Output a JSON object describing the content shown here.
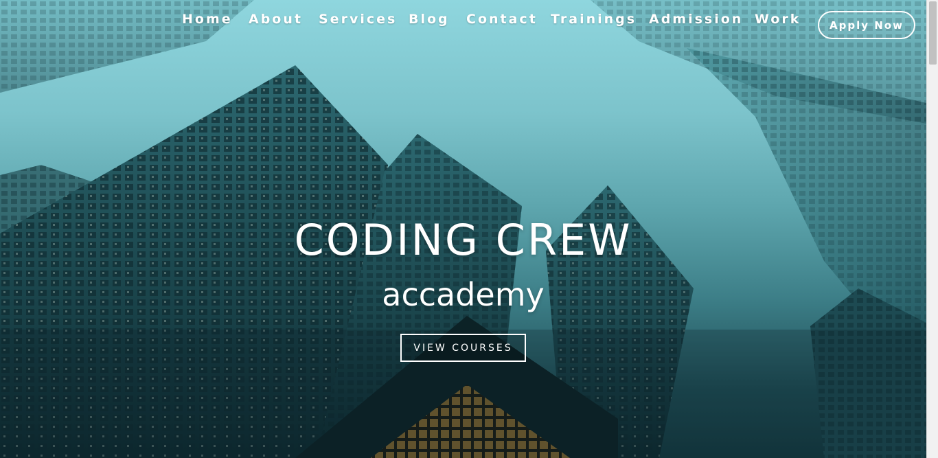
{
  "nav": {
    "items": [
      {
        "label": "Home"
      },
      {
        "label": "About"
      },
      {
        "label": "Services"
      },
      {
        "label": "Blog"
      },
      {
        "label": "Contact"
      },
      {
        "label": "Trainings"
      },
      {
        "label": "Admission"
      },
      {
        "label": "Work"
      }
    ],
    "apply_label": "Apply Now"
  },
  "hero": {
    "title": "CODING CREW",
    "subtitle": "accademy",
    "cta_label": "VIEW COURSES",
    "background": "city skyscrapers looking up, teal tint"
  },
  "colors": {
    "sky_top": "#8fd6de",
    "sky_bottom": "#143a41",
    "building_dark": "#0f2e34",
    "text": "#ffffff"
  }
}
